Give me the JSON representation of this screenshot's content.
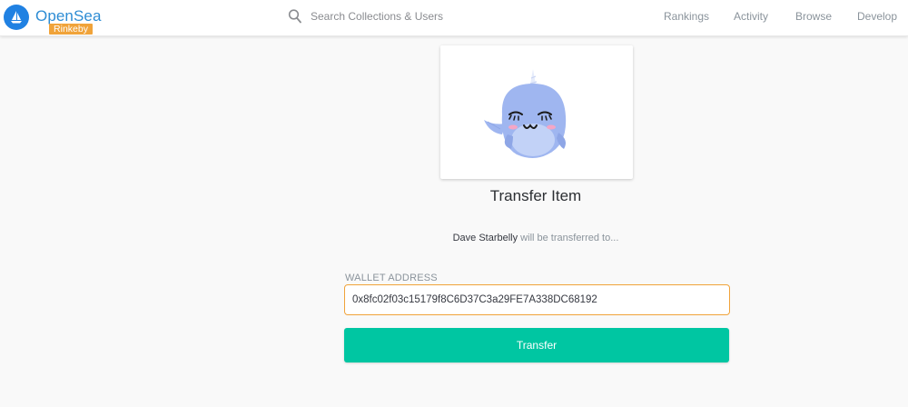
{
  "header": {
    "brand_name": "OpenSea",
    "network_badge": "Rinkeby",
    "search_placeholder": "Search Collections & Users",
    "nav": [
      {
        "label": "Rankings"
      },
      {
        "label": "Activity"
      },
      {
        "label": "Browse"
      },
      {
        "label": "Develop"
      }
    ]
  },
  "main": {
    "title": "Transfer Item",
    "item_name": "Dave Starbelly",
    "transfer_suffix": " will be transferred to...",
    "wallet_label": "WALLET ADDRESS",
    "wallet_value": "0x8fc02f03c15179f8C6D37C3a29FE7A338DC68192",
    "button_label": "Transfer"
  },
  "colors": {
    "brand_blue": "#2081e2",
    "badge_orange": "#f0a33a",
    "button_teal": "#00c6a2",
    "creature_body": "#9fb6f0"
  },
  "icons": {
    "logo": "sailboat-icon",
    "search": "search-icon"
  }
}
